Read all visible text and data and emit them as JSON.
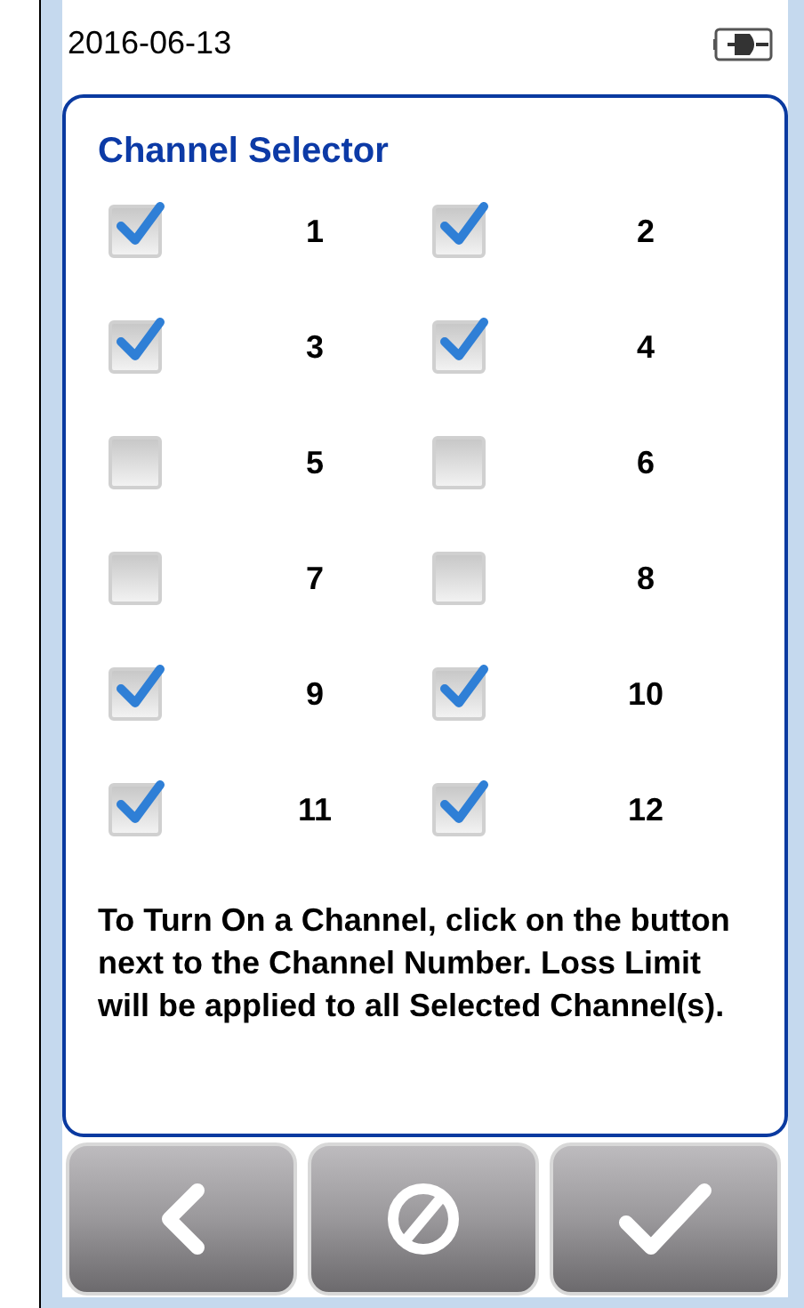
{
  "status_bar": {
    "date": "2016-06-13"
  },
  "panel": {
    "title": "Channel Selector",
    "channels": [
      {
        "label": "1",
        "checked": true
      },
      {
        "label": "2",
        "checked": true
      },
      {
        "label": "3",
        "checked": true
      },
      {
        "label": "4",
        "checked": true
      },
      {
        "label": "5",
        "checked": false
      },
      {
        "label": "6",
        "checked": false
      },
      {
        "label": "7",
        "checked": false
      },
      {
        "label": "8",
        "checked": false
      },
      {
        "label": "9",
        "checked": true
      },
      {
        "label": "10",
        "checked": true
      },
      {
        "label": "11",
        "checked": true
      },
      {
        "label": "12",
        "checked": true
      }
    ],
    "instructions": "To Turn On a Channel, click on the button next to the Channel Number. Loss Limit will be applied to all Selected Channel(s)."
  },
  "buttons": [
    {
      "kind": "back"
    },
    {
      "kind": "cancel"
    },
    {
      "kind": "confirm"
    }
  ]
}
